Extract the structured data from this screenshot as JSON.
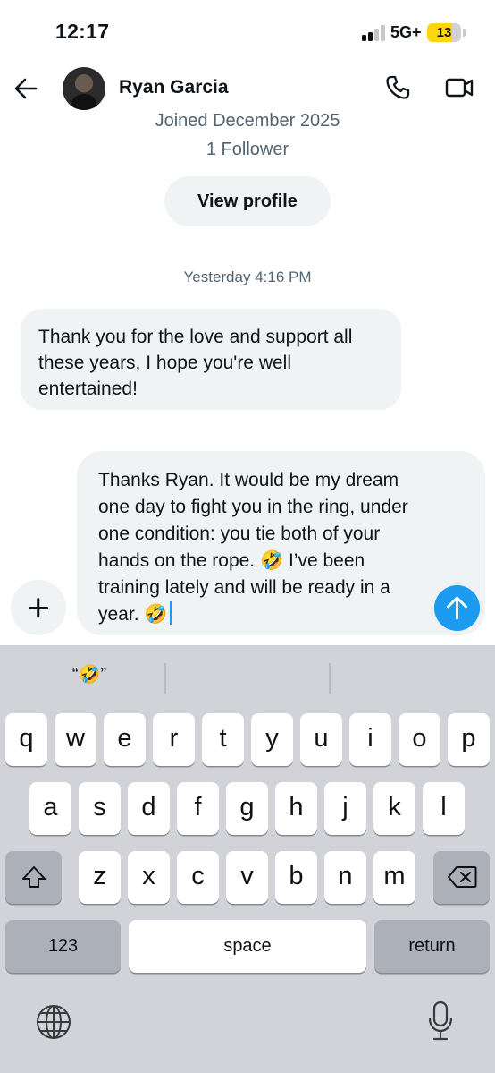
{
  "status_bar": {
    "time": "12:17",
    "network": "5G+",
    "battery": "13"
  },
  "header": {
    "name": "Ryan Garcia"
  },
  "profile": {
    "joined": "Joined December 2025",
    "followers": "1 Follower",
    "view_profile_label": "View profile"
  },
  "conversation": {
    "timestamp": "Yesterday 4:16 PM",
    "messages": [
      {
        "direction": "incoming",
        "text": "Thank you for the love and support all these years, I hope you're well entertained!"
      }
    ]
  },
  "composer": {
    "text": "Thanks Ryan. It would be my dream one day to fight you in the ring, under one condition: you tie both of your hands on the rope. 🤣 I’ve been training lately and will be ready in a year. 🤣"
  },
  "keyboard": {
    "suggestion": "“🤣”",
    "row1": [
      "q",
      "w",
      "e",
      "r",
      "t",
      "y",
      "u",
      "i",
      "o",
      "p"
    ],
    "row2": [
      "a",
      "s",
      "d",
      "f",
      "g",
      "h",
      "j",
      "k",
      "l"
    ],
    "row3": [
      "z",
      "x",
      "c",
      "v",
      "b",
      "n",
      "m"
    ],
    "numbers_label": "123",
    "space_label": "space",
    "return_label": "return"
  },
  "colors": {
    "accent": "#1d9bf0",
    "bubble": "#eff3f4",
    "muted_text": "#536471",
    "battery": "#ffd60a",
    "keyboard_bg": "#d1d3d9"
  }
}
